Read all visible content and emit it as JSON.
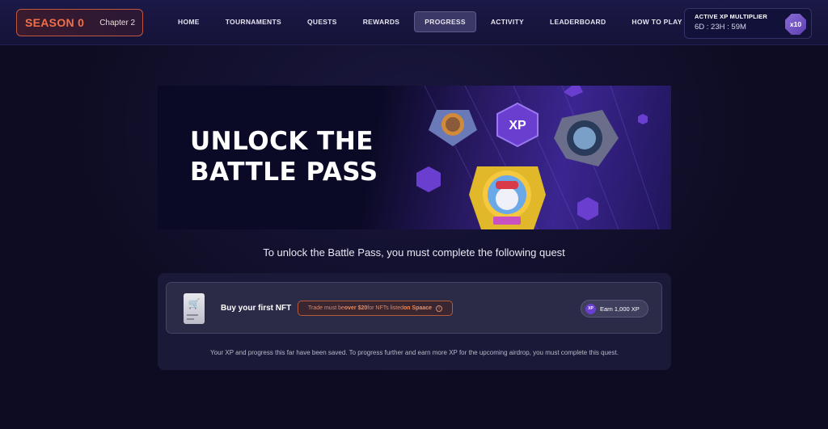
{
  "header": {
    "season_title": "SEASON 0",
    "season_chapter": "Chapter 2",
    "nav": [
      {
        "label": "HOME"
      },
      {
        "label": "TOURNAMENTS"
      },
      {
        "label": "QUESTS"
      },
      {
        "label": "REWARDS"
      },
      {
        "label": "PROGRESS",
        "active": true
      },
      {
        "label": "ACTIVITY"
      },
      {
        "label": "LEADERBOARD"
      },
      {
        "label": "HOW TO PLAY"
      }
    ],
    "xp_multiplier": {
      "title": "ACTIVE XP MULTIPLIER",
      "timer": "6D : 23H : 59M",
      "badge": "x10"
    }
  },
  "banner": {
    "title_line1": "UNLOCK THE",
    "title_line2": "BATTLE PASS",
    "art_xp_badge": "XP"
  },
  "subtitle": "To unlock the Battle Pass, you must complete the following quest",
  "quest": {
    "name": "Buy your first NFT",
    "requirement_prefix": "Trade must be ",
    "requirement_amount": "over $20",
    "requirement_middle": " for NFTs listed ",
    "requirement_venue": "on Spaace",
    "requirement_info_icon": "i",
    "reward_icon_text": "XP",
    "reward_label": "Earn 1,000 XP",
    "note": "Your XP and progress this far have been saved. To progress further and earn more XP for the upcoming airdrop, you must complete this quest."
  },
  "colors": {
    "accent_orange": "#f07048",
    "background": "#0e0c22",
    "purple": "#6a3fd0"
  }
}
